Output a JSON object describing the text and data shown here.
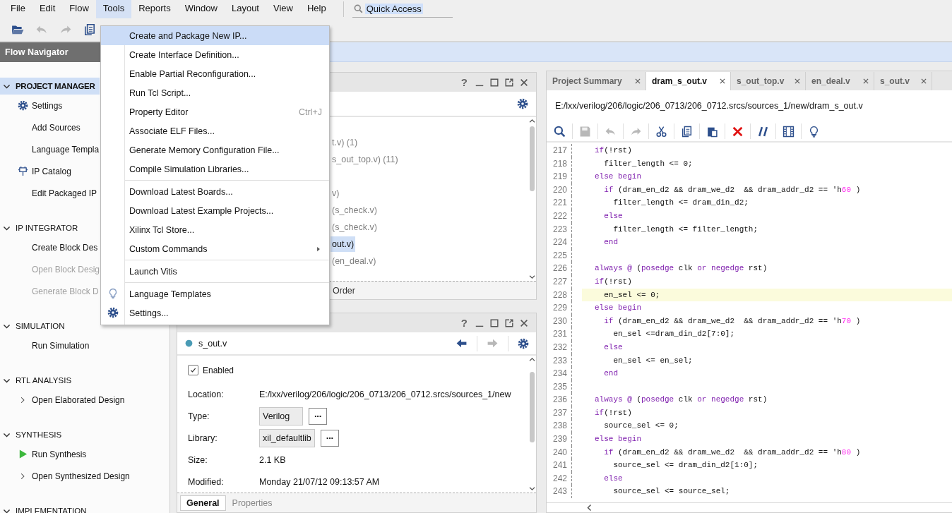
{
  "menubar": {
    "items": [
      {
        "label": "File",
        "selected": false
      },
      {
        "label": "Edit",
        "selected": false
      },
      {
        "label": "Flow",
        "selected": false
      },
      {
        "label": "Tools",
        "selected": true
      },
      {
        "label": "Reports",
        "selected": false
      },
      {
        "label": "Window",
        "selected": false
      },
      {
        "label": "Layout",
        "selected": false
      },
      {
        "label": "View",
        "selected": false
      },
      {
        "label": "Help",
        "selected": false
      }
    ],
    "quick_access": {
      "value": "Quick Access"
    }
  },
  "toolbar": {
    "buttons": [
      {
        "kind": "open",
        "disabled": false
      },
      {
        "kind": "undo",
        "disabled": true
      },
      {
        "kind": "redo",
        "disabled": true
      },
      {
        "kind": "copy",
        "disabled": false
      }
    ]
  },
  "flow_navigator": {
    "title": "Flow Navigator",
    "sections": [
      {
        "title": "PROJECT MANAGER",
        "expanded": true,
        "selected": true,
        "items": [
          {
            "label": "Settings",
            "kind": "settings",
            "disabled": false
          },
          {
            "label": "Add Sources",
            "kind": "action",
            "disabled": false
          },
          {
            "label": "Language Templa",
            "kind": "action",
            "disabled": false
          },
          {
            "label": "IP Catalog",
            "kind": "catalog",
            "disabled": false
          },
          {
            "label": "Edit Packaged IP",
            "kind": "action",
            "disabled": false
          }
        ]
      },
      {
        "title": "IP INTEGRATOR",
        "expanded": true,
        "selected": false,
        "items": [
          {
            "label": "Create Block Des",
            "kind": "action",
            "disabled": false
          },
          {
            "label": "Open Block Desig",
            "kind": "action",
            "disabled": true
          },
          {
            "label": "Generate Block D",
            "kind": "action",
            "disabled": true
          }
        ]
      },
      {
        "title": "SIMULATION",
        "expanded": true,
        "selected": false,
        "items": [
          {
            "label": "Run Simulation",
            "kind": "action",
            "disabled": false
          }
        ]
      },
      {
        "title": "RTL ANALYSIS",
        "expanded": true,
        "selected": false,
        "items": [
          {
            "label": "Open Elaborated Design",
            "kind": "group",
            "disabled": false
          }
        ]
      },
      {
        "title": "SYNTHESIS",
        "expanded": true,
        "selected": false,
        "items": [
          {
            "label": "Run Synthesis",
            "kind": "run",
            "disabled": false
          },
          {
            "label": "Open Synthesized Design",
            "kind": "group",
            "disabled": false
          }
        ]
      },
      {
        "title": "IMPLEMENTATION",
        "expanded": true,
        "selected": false
      }
    ]
  },
  "tools_menu": {
    "items": [
      {
        "kind": "item",
        "label": "Create and Package New IP...",
        "selected": true
      },
      {
        "kind": "item",
        "label": "Create Interface Definition...",
        "selected": false
      },
      {
        "kind": "item",
        "label": "Enable Partial Reconfiguration...",
        "selected": false
      },
      {
        "kind": "item",
        "label": "Run Tcl Script...",
        "selected": false
      },
      {
        "kind": "item",
        "label": "Property Editor",
        "shortcut": "Ctrl+J",
        "selected": false
      },
      {
        "kind": "item",
        "label": "Associate ELF Files...",
        "selected": false
      },
      {
        "kind": "item",
        "label": "Generate Memory Configuration File...",
        "selected": false
      },
      {
        "kind": "item",
        "label": "Compile Simulation Libraries...",
        "selected": false
      },
      {
        "kind": "separator"
      },
      {
        "kind": "item",
        "label": "Download Latest Boards...",
        "selected": false
      },
      {
        "kind": "item",
        "label": "Download Latest Example Projects...",
        "selected": false
      },
      {
        "kind": "item",
        "label": "Xilinx Tcl Store...",
        "selected": false
      },
      {
        "kind": "submenu",
        "label": "Custom Commands",
        "selected": false
      },
      {
        "kind": "separator"
      },
      {
        "kind": "item",
        "label": "Launch Vitis",
        "selected": false
      },
      {
        "kind": "separator"
      },
      {
        "kind": "templates",
        "label": "Language Templates",
        "selected": false
      },
      {
        "kind": "settings",
        "label": "Settings...",
        "selected": false
      }
    ]
  },
  "sources_panel": {
    "help": "?",
    "tree_rows": [
      {
        "text": "t.v) (1)",
        "selected": false
      },
      {
        "text": "s_out_top.v) (11)",
        "selected": false
      },
      {
        "text": "v)",
        "selected": false
      },
      {
        "text": "(s_check.v)",
        "selected": false
      },
      {
        "text": "(s_check.v)",
        "selected": false
      },
      {
        "text": "out.v)",
        "selected": true
      },
      {
        "text": "(en_deal.v)",
        "selected": false
      }
    ],
    "tabs": [
      {
        "label": "Order",
        "selected": false
      }
    ]
  },
  "properties_panel": {
    "help": "?",
    "file": "s_out.v",
    "enabled": true,
    "enabled_label": "Enabled",
    "fields": [
      {
        "label": "Location:",
        "value": "E:/lxx/verilog/206/logic/206_0713/206_0712.srcs/sources_1/new",
        "kind": "text"
      },
      {
        "label": "Type:",
        "value": "Verilog",
        "kind": "choice",
        "more": "···"
      },
      {
        "label": "Library:",
        "value": "xil_defaultlib",
        "kind": "choice",
        "more": "···"
      },
      {
        "label": "Size:",
        "value": "2.1 KB",
        "kind": "text"
      },
      {
        "label": "Modified:",
        "value": "Monday 21/07/12 09:13:57 AM",
        "kind": "text"
      }
    ],
    "tabs": [
      {
        "label": "General",
        "selected": true
      },
      {
        "label": "Properties",
        "selected": false
      }
    ]
  },
  "editor": {
    "tabs": [
      {
        "label": "Project Summary",
        "selected": false
      },
      {
        "label": "dram_s_out.v",
        "selected": true
      },
      {
        "label": "s_out_top.v",
        "selected": false
      },
      {
        "label": "en_deal.v",
        "selected": false
      },
      {
        "label": "s_out.v",
        "selected": false
      }
    ],
    "path": "E:/lxx/verilog/206/logic/206_0713/206_0712.srcs/sources_1/new/dram_s_out.v",
    "toolbar": [
      {
        "kind": "search",
        "disabled": false
      },
      {
        "kind": "save",
        "disabled": true
      },
      {
        "kind": "undo",
        "disabled": true
      },
      {
        "kind": "redo",
        "disabled": true
      },
      {
        "kind": "cut",
        "disabled": false
      },
      {
        "kind": "copy",
        "disabled": false
      },
      {
        "kind": "paste",
        "disabled": false
      },
      {
        "kind": "delete",
        "disabled": false
      },
      {
        "kind": "comment",
        "disabled": false
      },
      {
        "kind": "columns",
        "disabled": false
      },
      {
        "kind": "bulb",
        "disabled": false
      }
    ],
    "lines": [
      {
        "number": "217",
        "current": false,
        "tokens": [
          {
            "text": "if",
            "kind": "keyword"
          },
          {
            "text": "(!rst)",
            "kind": "plain"
          }
        ]
      },
      {
        "number": "218",
        "current": false,
        "tokens": [
          {
            "text": "  filter_length <= 0;",
            "kind": "plain"
          }
        ]
      },
      {
        "number": "219",
        "current": false,
        "tokens": [
          {
            "text": "else begin",
            "kind": "keyword"
          }
        ]
      },
      {
        "number": "220",
        "current": false,
        "tokens": [
          {
            "text": "  if",
            "kind": "keyword"
          },
          {
            "text": " (dram_en_d2 && dram_we_d2  && dram_addr_d2 == 'h",
            "kind": "plain"
          },
          {
            "text": "60",
            "kind": "number"
          },
          {
            "text": " )",
            "kind": "plain"
          }
        ]
      },
      {
        "number": "221",
        "current": false,
        "tokens": [
          {
            "text": "    filter_length <= dram_din_d2;",
            "kind": "plain"
          }
        ]
      },
      {
        "number": "222",
        "current": false,
        "tokens": [
          {
            "text": "  else",
            "kind": "keyword"
          }
        ]
      },
      {
        "number": "223",
        "current": false,
        "tokens": [
          {
            "text": "    filter_length <= filter_length;",
            "kind": "plain"
          }
        ]
      },
      {
        "number": "224",
        "current": false,
        "tokens": [
          {
            "text": "  end",
            "kind": "keyword"
          }
        ]
      },
      {
        "number": "225",
        "current": false
      },
      {
        "number": "226",
        "current": false,
        "tokens": [
          {
            "text": "always @",
            "kind": "keyword"
          },
          {
            "text": " (",
            "kind": "plain"
          },
          {
            "text": "posedge",
            "kind": "keyword"
          },
          {
            "text": " clk ",
            "kind": "plain"
          },
          {
            "text": "or negedge",
            "kind": "keyword"
          },
          {
            "text": " rst)",
            "kind": "plain"
          }
        ]
      },
      {
        "number": "227",
        "current": false,
        "tokens": [
          {
            "text": "if",
            "kind": "keyword"
          },
          {
            "text": "(!rst)",
            "kind": "plain"
          }
        ]
      },
      {
        "number": "228",
        "current": true,
        "tokens": [
          {
            "text": "  en_sel <= 0;",
            "kind": "plain"
          }
        ]
      },
      {
        "number": "229",
        "current": false,
        "tokens": [
          {
            "text": "else begin",
            "kind": "keyword"
          }
        ]
      },
      {
        "number": "230",
        "current": false,
        "tokens": [
          {
            "text": "  if",
            "kind": "keyword"
          },
          {
            "text": " (dram_en_d2 && dram_we_d2  && dram_addr_d2 == 'h",
            "kind": "plain"
          },
          {
            "text": "70",
            "kind": "number"
          },
          {
            "text": " )",
            "kind": "plain"
          }
        ]
      },
      {
        "number": "231",
        "current": false,
        "tokens": [
          {
            "text": "    en_sel <=dram_din_d2[7:0];",
            "kind": "plain"
          }
        ]
      },
      {
        "number": "232",
        "current": false,
        "tokens": [
          {
            "text": "  else",
            "kind": "keyword"
          }
        ]
      },
      {
        "number": "233",
        "current": false,
        "tokens": [
          {
            "text": "    en_sel <= en_sel;",
            "kind": "plain"
          }
        ]
      },
      {
        "number": "234",
        "current": false,
        "tokens": [
          {
            "text": "  end",
            "kind": "keyword"
          }
        ]
      },
      {
        "number": "235",
        "current": false
      },
      {
        "number": "236",
        "current": false,
        "tokens": [
          {
            "text": "always @",
            "kind": "keyword"
          },
          {
            "text": " (",
            "kind": "plain"
          },
          {
            "text": "posedge",
            "kind": "keyword"
          },
          {
            "text": " clk ",
            "kind": "plain"
          },
          {
            "text": "or negedge",
            "kind": "keyword"
          },
          {
            "text": " rst)",
            "kind": "plain"
          }
        ]
      },
      {
        "number": "237",
        "current": false,
        "tokens": [
          {
            "text": "if",
            "kind": "keyword"
          },
          {
            "text": "(!rst)",
            "kind": "plain"
          }
        ]
      },
      {
        "number": "238",
        "current": false,
        "tokens": [
          {
            "text": "  source_sel <= 0;",
            "kind": "plain"
          }
        ]
      },
      {
        "number": "239",
        "current": false,
        "tokens": [
          {
            "text": "else begin",
            "kind": "keyword"
          }
        ]
      },
      {
        "number": "240",
        "current": false,
        "tokens": [
          {
            "text": "  if",
            "kind": "keyword"
          },
          {
            "text": " (dram_en_d2 && dram_we_d2  && dram_addr_d2 == 'h",
            "kind": "plain"
          },
          {
            "text": "80",
            "kind": "number"
          },
          {
            "text": " )",
            "kind": "plain"
          }
        ]
      },
      {
        "number": "241",
        "current": false,
        "tokens": [
          {
            "text": "    source_sel <= dram_din_d2[1:0];",
            "kind": "plain"
          }
        ]
      },
      {
        "number": "242",
        "current": false,
        "tokens": [
          {
            "text": "  else",
            "kind": "keyword"
          }
        ]
      },
      {
        "number": "243",
        "current": false,
        "tokens": [
          {
            "text": "    source_sel <= source_sel;",
            "kind": "plain"
          }
        ]
      }
    ]
  }
}
